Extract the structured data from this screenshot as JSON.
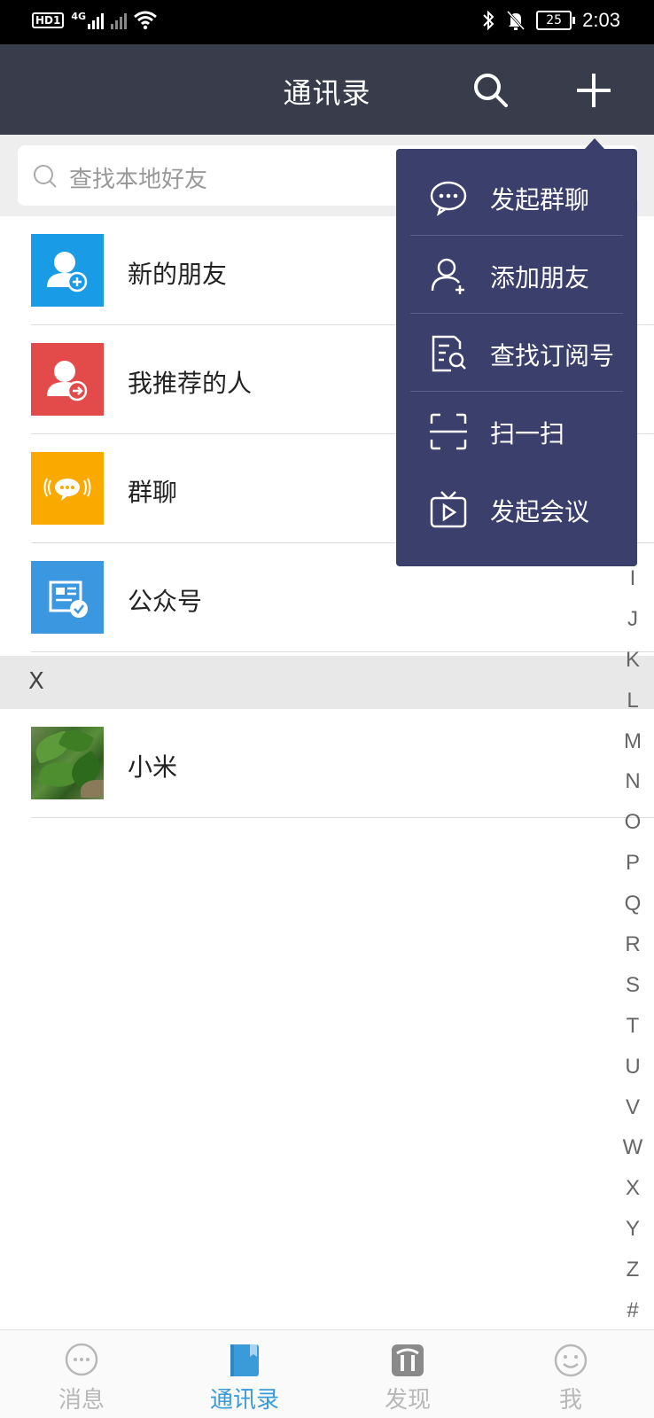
{
  "status_bar": {
    "left_badges": [
      "HD1",
      "4G"
    ],
    "battery": "25",
    "time": "2:03"
  },
  "header": {
    "title": "通讯录",
    "search_icon": "search-icon",
    "add_icon": "plus-icon"
  },
  "search": {
    "placeholder": "查找本地好友"
  },
  "contacts": {
    "fixed_items": [
      {
        "label": "新的朋友",
        "icon": "new-friend-icon",
        "color": "#1a9be6"
      },
      {
        "label": "我推荐的人",
        "icon": "recommend-icon",
        "color": "#e34b4b"
      },
      {
        "label": "群聊",
        "icon": "group-chat-icon",
        "color": "#f9a900"
      },
      {
        "label": "公众号",
        "icon": "official-account-icon",
        "color": "#3b98e0"
      }
    ],
    "sections": [
      {
        "letter": "X",
        "items": [
          {
            "label": "小米"
          }
        ]
      }
    ]
  },
  "alphabet_index": [
    "I",
    "J",
    "K",
    "L",
    "M",
    "N",
    "O",
    "P",
    "Q",
    "R",
    "S",
    "T",
    "U",
    "V",
    "W",
    "X",
    "Y",
    "Z",
    "#"
  ],
  "dropdown_menu": {
    "items": [
      {
        "label": "发起群聊",
        "icon": "chat-bubble-icon"
      },
      {
        "label": "添加朋友",
        "icon": "add-user-icon"
      },
      {
        "label": "查找订阅号",
        "icon": "search-document-icon"
      },
      {
        "label": "扫一扫",
        "icon": "scan-icon"
      },
      {
        "label": "发起会议",
        "icon": "meeting-tv-icon"
      }
    ],
    "background_color": "#3b3f6b"
  },
  "tab_bar": {
    "tabs": [
      {
        "label": "消息",
        "icon": "message-icon",
        "active": false
      },
      {
        "label": "通讯录",
        "icon": "contacts-book-icon",
        "active": true
      },
      {
        "label": "发现",
        "icon": "discover-icon",
        "active": false
      },
      {
        "label": "我",
        "icon": "me-smile-icon",
        "active": false
      }
    ],
    "active_color": "#3a9bd8"
  }
}
